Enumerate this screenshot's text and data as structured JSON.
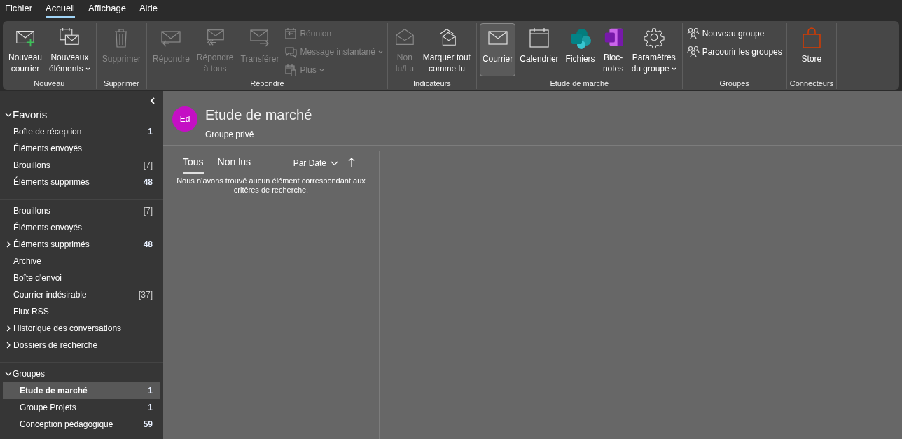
{
  "menu": [
    {
      "label": "Fichier",
      "selected": false
    },
    {
      "label": "Accueil",
      "selected": true
    },
    {
      "label": "Affichage",
      "selected": false
    },
    {
      "label": "Aide",
      "selected": false
    }
  ],
  "ribbon": [
    {
      "label": "Nouveau",
      "items": [
        {
          "kind": "large",
          "label": "Nouveau\ncourrier",
          "disabled": false
        },
        {
          "kind": "large",
          "label": "Nouveaux\néléments",
          "disabled": false,
          "dropdown": true
        }
      ]
    },
    {
      "label": "Supprimer",
      "items": [
        {
          "kind": "large",
          "label": "Supprimer",
          "disabled": true
        }
      ]
    },
    {
      "label": "Répondre",
      "items": [
        {
          "kind": "large",
          "label": "Répondre",
          "disabled": true
        },
        {
          "kind": "large",
          "label": "Répondre\nà tous",
          "disabled": true
        },
        {
          "kind": "large",
          "label": "Transférer",
          "disabled": true
        },
        {
          "kind": "small",
          "label": "Réunion",
          "disabled": true
        },
        {
          "kind": "small",
          "label": "Message instantané",
          "disabled": true,
          "dropdown": true
        },
        {
          "kind": "small",
          "label": "Plus",
          "disabled": true,
          "dropdown": true
        }
      ]
    },
    {
      "label": "Indicateurs",
      "items": [
        {
          "kind": "large",
          "label": "Non\nlu/Lu",
          "disabled": true
        },
        {
          "kind": "large",
          "label": "Marquer tout\ncomme lu",
          "disabled": false
        }
      ]
    },
    {
      "label": "Etude de marché",
      "items": [
        {
          "kind": "large",
          "label": "Courrier",
          "disabled": false,
          "selected": true
        },
        {
          "kind": "large",
          "label": "Calendrier",
          "disabled": false,
          "selected": false
        },
        {
          "kind": "large",
          "label": "Fichiers",
          "disabled": false,
          "selected": false
        },
        {
          "kind": "large",
          "label": "Bloc-\nnotes",
          "disabled": false,
          "selected": false
        },
        {
          "kind": "large",
          "label": "Paramètres\ndu groupe",
          "disabled": false,
          "dropdown": true
        }
      ]
    },
    {
      "label": "Groupes",
      "items": [
        {
          "kind": "small",
          "label": "Nouveau groupe",
          "disabled": false
        },
        {
          "kind": "small",
          "label": "Parcourir les groupes",
          "disabled": false
        }
      ]
    },
    {
      "label": "Connecteurs",
      "items": [
        {
          "kind": "large",
          "label": "Store",
          "disabled": false
        }
      ]
    }
  ],
  "sidebar": {
    "sections": [
      {
        "title": "Favoris",
        "expanded": true,
        "items": [
          {
            "name": "Boîte de réception",
            "count": "1",
            "unread": true,
            "selected": false
          },
          {
            "name": "Éléments envoyés",
            "selected": false
          },
          {
            "name": "Brouillons",
            "count": "[7]",
            "unread": false,
            "selected": false
          },
          {
            "name": "Éléments supprimés",
            "count": "48",
            "unread": true,
            "selected": false
          }
        ]
      },
      {
        "items": [
          {
            "name": "Brouillons",
            "count": "[7]",
            "unread": false,
            "selected": false
          },
          {
            "name": "Éléments envoyés",
            "selected": false
          },
          {
            "name": "Éléments supprimés",
            "count": "48",
            "unread": true,
            "expanded": false,
            "selected": false
          },
          {
            "name": "Archive",
            "selected": false
          },
          {
            "name": "Boîte d'envoi",
            "selected": false
          },
          {
            "name": "Courrier indésirable",
            "count": "[37]",
            "unread": false,
            "selected": false
          },
          {
            "name": "Flux RSS",
            "selected": false
          },
          {
            "name": "Historique des conversations",
            "expanded": false,
            "selected": false
          },
          {
            "name": "Dossiers de recherche",
            "expanded": false,
            "selected": false
          }
        ]
      },
      {
        "title": "Groupes",
        "expanded": true,
        "nested": true,
        "items": [
          {
            "name": "Etude de marché",
            "count": "1",
            "unread": true,
            "selected": true
          },
          {
            "name": "Groupe Projets",
            "count": "1",
            "unread": true,
            "selected": false
          },
          {
            "name": "Conception pédagogique",
            "count": "59",
            "unread": true,
            "selected": false
          }
        ]
      }
    ]
  },
  "group_header": {
    "avatar": "Ed",
    "color": "#c40fc4",
    "title": "Etude de marché",
    "subtitle": "Groupe privé"
  },
  "message_list": {
    "tabs": [
      {
        "label": "Tous",
        "selected": true
      },
      {
        "label": "Non lus",
        "selected": false
      }
    ],
    "sort": "Par Date",
    "empty_message": "Nous n’avons trouvé aucun élément correspondant aux critères de recherche."
  }
}
